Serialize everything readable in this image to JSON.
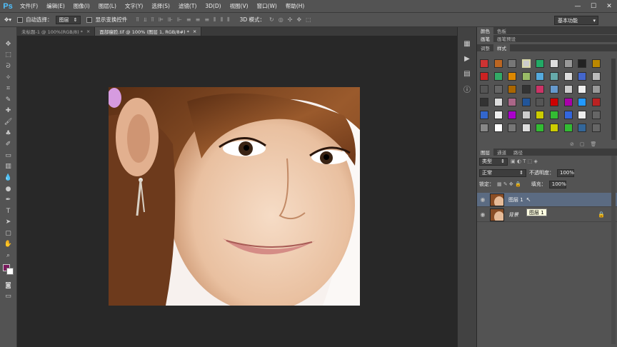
{
  "app": {
    "logo": "Ps"
  },
  "menu": [
    "文件(F)",
    "编辑(E)",
    "图像(I)",
    "图层(L)",
    "文字(Y)",
    "选择(S)",
    "滤镜(T)",
    "3D(D)",
    "视图(V)",
    "窗口(W)",
    "帮助(H)"
  ],
  "window_controls": [
    "—",
    "☐",
    "✕"
  ],
  "options": {
    "auto_select_label": "自动选择：",
    "auto_select_value": "图层",
    "show_transform_label": "显示变换控件",
    "mode_3d_label": "3D 模式：",
    "workspace": "基本功能"
  },
  "documents": [
    {
      "title": "未标题-1 @ 100%(RGB/8) *",
      "close": "×"
    },
    {
      "title": "面部瘦脸.tif @ 100% (图层 1, RGB/8#) *",
      "close": "×"
    }
  ],
  "panels": {
    "top_tabs": [
      "颜色",
      "色板"
    ],
    "mid_tabs": [
      "画笔",
      "画笔预设"
    ],
    "style_tabs": [
      "调整",
      "样式"
    ],
    "layers_tabs": [
      "图层",
      "通道",
      "路径"
    ]
  },
  "layers_panel": {
    "filter_kind": "类型",
    "blend_mode": "正常",
    "opacity_label": "不透明度：",
    "opacity_value": "100%",
    "lock_label": "锁定：",
    "fill_label": "填充：",
    "fill_value": "100%",
    "layers": [
      {
        "name": "图层 1",
        "selected": true
      },
      {
        "name": "背景",
        "locked": true
      }
    ],
    "tooltip": "图层 1"
  },
  "colors": {
    "foreground": "#7a1b5e",
    "background": "#ffffff",
    "selected_layer": "#5b6b82"
  },
  "icons": {
    "tools": [
      "move-icon",
      "marquee-icon",
      "lasso-icon",
      "quick-select-icon",
      "crop-icon",
      "eyedropper-icon",
      "healing-brush-icon",
      "brush-icon",
      "clone-stamp-icon",
      "history-brush-icon",
      "eraser-icon",
      "gradient-icon",
      "blur-icon",
      "dodge-icon",
      "pen-icon",
      "type-icon",
      "path-select-icon",
      "shape-icon",
      "hand-icon",
      "zoom-icon"
    ]
  }
}
